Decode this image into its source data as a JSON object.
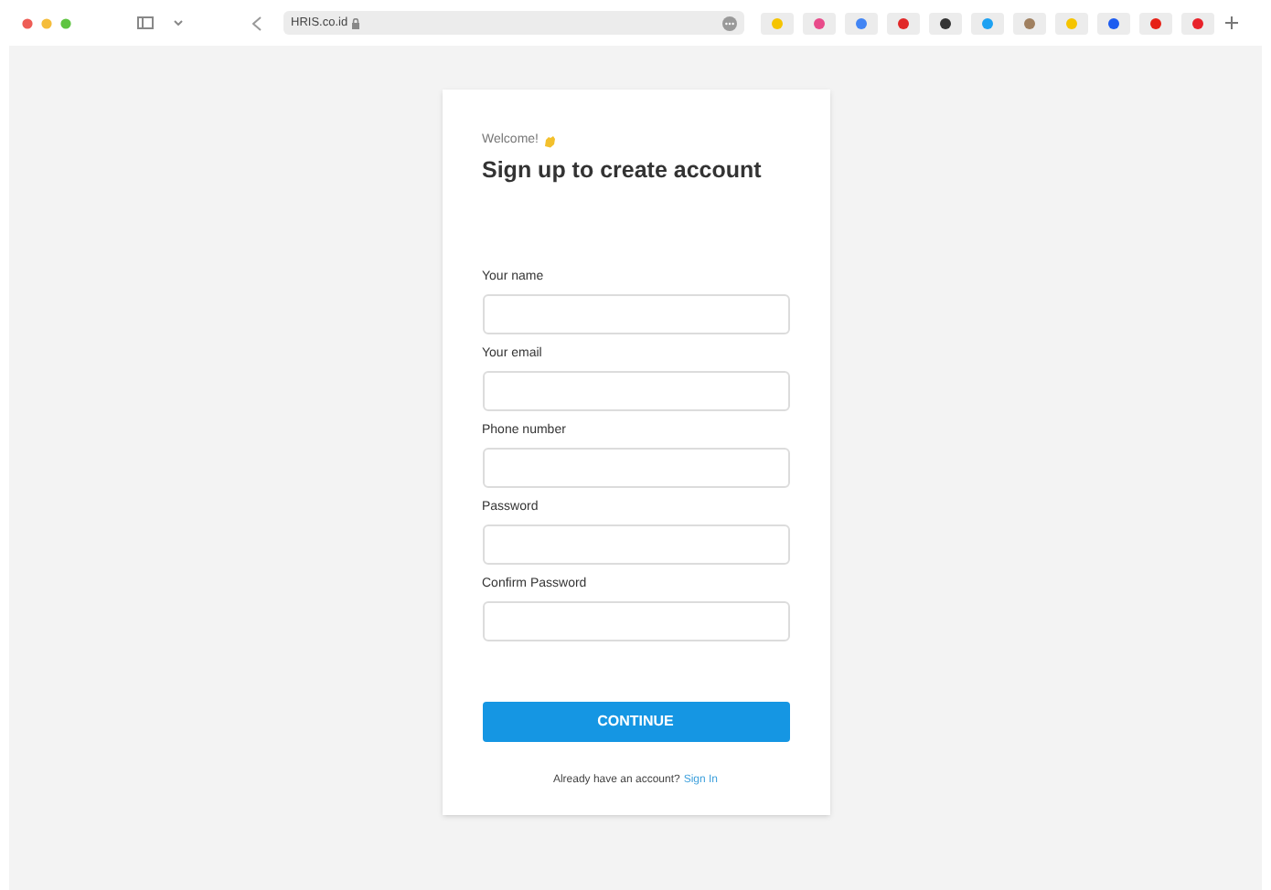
{
  "browser": {
    "url": "HRIS.co.id"
  },
  "form": {
    "greeting": "Welcome!",
    "title": "Sign up to create account",
    "fields": [
      {
        "label": "Your name"
      },
      {
        "label": "Your email"
      },
      {
        "label": "Phone number"
      },
      {
        "label": "Password"
      },
      {
        "label": "Confirm Password"
      }
    ],
    "submit": "CONTINUE",
    "footer": {
      "text": "Already have an account?",
      "link": "Sign In"
    }
  }
}
